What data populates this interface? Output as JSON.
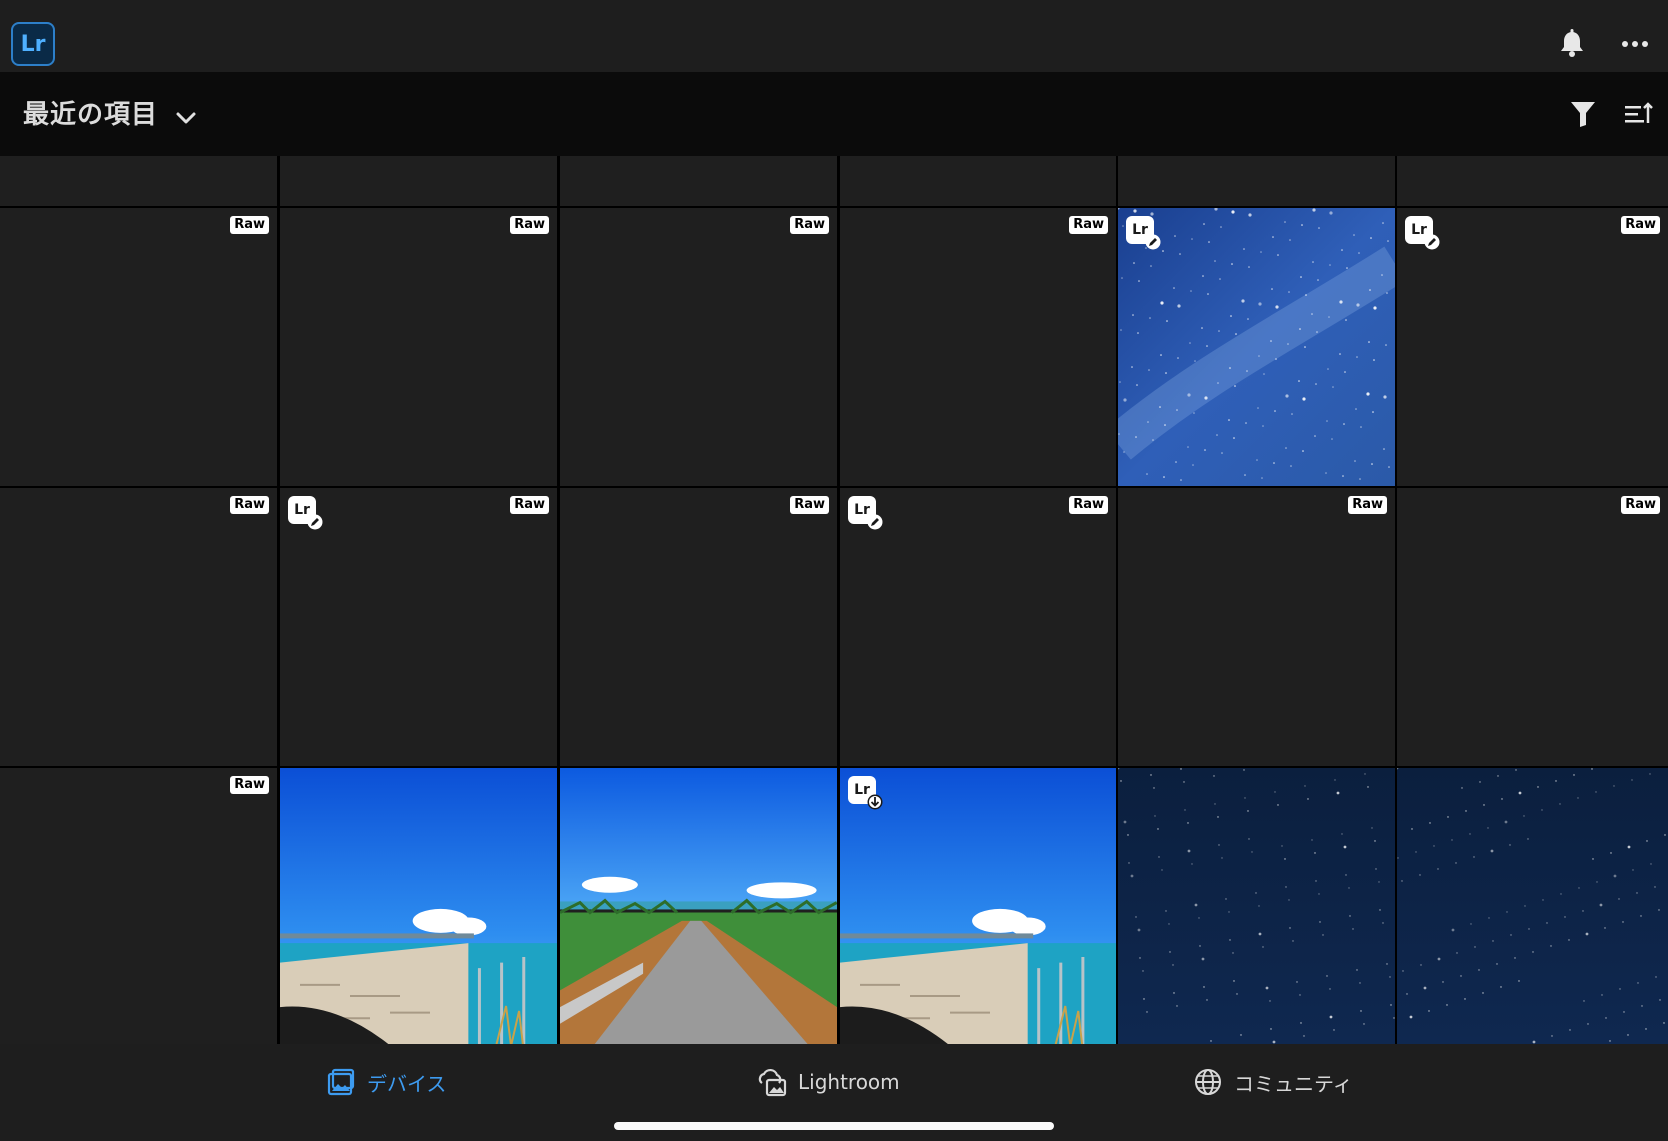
{
  "app": {
    "logo_text": "Lr",
    "accent": "#3d9bf0"
  },
  "topbar": {
    "icons": [
      "bell-icon",
      "more-icon"
    ]
  },
  "subheader": {
    "title": "最近の項目",
    "icons": [
      "chevron-down-icon",
      "filter-icon",
      "sort-icon"
    ]
  },
  "badges": {
    "raw": "Raw",
    "lr": "Lr"
  },
  "grid": {
    "rows": [
      {
        "cells": [
          {
            "raw": true,
            "lr": null,
            "photo": null
          },
          {
            "raw": true,
            "lr": null,
            "photo": null
          },
          {
            "raw": true,
            "lr": null,
            "photo": null
          },
          {
            "raw": true,
            "lr": null,
            "photo": null
          },
          {
            "raw": false,
            "lr": "edited",
            "photo": "milky-way-blue"
          },
          {
            "raw": true,
            "lr": "edited",
            "photo": null
          }
        ]
      },
      {
        "cells": [
          {
            "raw": true,
            "lr": null,
            "photo": null
          },
          {
            "raw": true,
            "lr": "edited",
            "photo": null
          },
          {
            "raw": true,
            "lr": null,
            "photo": null
          },
          {
            "raw": true,
            "lr": "edited",
            "photo": null
          },
          {
            "raw": true,
            "lr": null,
            "photo": null
          },
          {
            "raw": true,
            "lr": null,
            "photo": null
          }
        ]
      },
      {
        "cells": [
          {
            "raw": true,
            "lr": null,
            "photo": null
          },
          {
            "raw": false,
            "lr": null,
            "photo": "bridge-sea"
          },
          {
            "raw": false,
            "lr": null,
            "photo": "road-sugarcane"
          },
          {
            "raw": false,
            "lr": "download",
            "photo": "bridge-sea"
          },
          {
            "raw": false,
            "lr": null,
            "photo": "night-sky"
          },
          {
            "raw": false,
            "lr": null,
            "photo": "night-sky"
          }
        ]
      }
    ]
  },
  "bottombar": {
    "tabs": [
      {
        "label": "デバイス",
        "icon": "device-photos-icon",
        "active": true
      },
      {
        "label": "Lightroom",
        "icon": "cloud-photos-icon",
        "active": false
      },
      {
        "label": "コミュニティ",
        "icon": "globe-icon",
        "active": false
      }
    ]
  }
}
